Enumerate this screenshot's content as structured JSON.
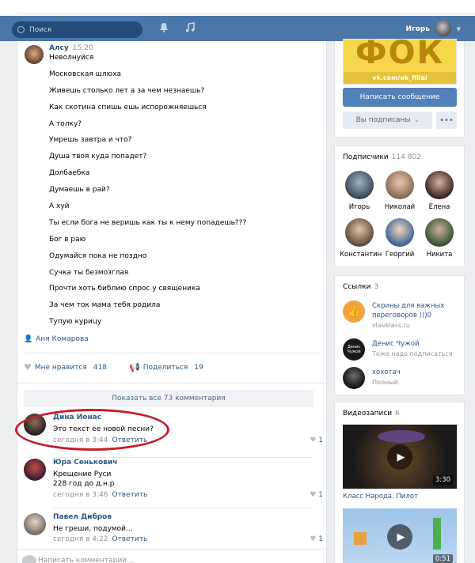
{
  "header": {
    "search_placeholder": "Поиск",
    "user_name": "Игорь",
    "icons": [
      "search-icon",
      "bell-icon",
      "music-icon",
      "chevron-down-icon"
    ]
  },
  "post": {
    "author": "Алсу",
    "time": "15:20",
    "lines": [
      "Неволнуйся",
      "Московская шлюха",
      "Живешь столько лет а за чем незнаешь?",
      "Как скотина спишь ешь испорожняешься",
      "А толку?",
      "Умрешь завтра и что?",
      "Душа твоя куда попадет?",
      "Долбаебка",
      "Думаешь в рай?",
      "А хуй",
      "Ты если бога не веришь как ты к нему попадешь???",
      "Бог в раю",
      "Одумайся пока не поздно",
      "Сучка ты безмозглая",
      "Прочти хоть библию спрос у священика",
      "За чем ток мама тебя родила",
      "Тупую курицу"
    ],
    "mention": "Аня Комарова",
    "likes_label": "Мне нравится",
    "likes_count": "418",
    "share_label": "Поделиться",
    "share_count": "19"
  },
  "comments": {
    "show_all": "Показать все 73 комментария",
    "items": [
      {
        "name": "Дина Ионас",
        "text": [
          "Это текст ее новой песни?"
        ],
        "time": "сегодня в 3:44",
        "reply": "Ответить",
        "likes": "1"
      },
      {
        "name": "Юра Сенькович",
        "text": [
          "Крещение Руси",
          "228 год до д.н.р"
        ],
        "time": "сегодня в 3:46",
        "reply": "Ответить",
        "likes": "1"
      },
      {
        "name": "Павел Дибров",
        "text": [
          "Не греши, подумой..."
        ],
        "time": "сегодня в 4:22",
        "reply": "Ответить",
        "likes": "1"
      }
    ],
    "write_placeholder": "Написать комментарий..."
  },
  "sidebar": {
    "logo_text": "ФОК",
    "logo_url": "vk.com/ok_filial",
    "write_message": "Написать сообщение",
    "subscribed": "Вы подписаны",
    "more": "•••",
    "subscribers_title": "Подписчики",
    "subscribers_count": "114 802",
    "subscribers": [
      "Игорь",
      "Николай",
      "Елена",
      "Константин",
      "Георгий",
      "Никита"
    ],
    "links_title": "Ссылки",
    "links_count": "3",
    "links": [
      {
        "title": "Скрины для важных переговоров )))0",
        "sub": "stavklass.ru"
      },
      {
        "title": "Денис Чужой",
        "sub": "Тоже надо подписаться",
        "avatar_text": "Денис Чужой"
      },
      {
        "title": "хохотач",
        "sub": "Полный."
      }
    ],
    "videos_title": "Видеозаписи",
    "videos_count": "6",
    "video1_duration": "3:30",
    "video1_title": "Класс Народа. Пилот",
    "video2_duration": "0:51"
  },
  "colors": {
    "header": "#4a76a8",
    "link": "#2a5885",
    "button": "#5181b8",
    "highlight_oval": "#c41e2d",
    "logo_yellow": "#f7d64a"
  }
}
